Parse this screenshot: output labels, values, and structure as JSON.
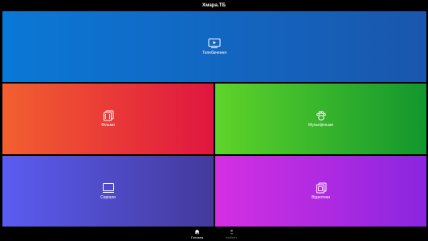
{
  "app": {
    "title": "Хмара.ТБ"
  },
  "tiles": [
    {
      "id": "tv",
      "label": "Телебачення",
      "icon": "tv-icon"
    },
    {
      "id": "films",
      "label": "Фільми",
      "icon": "film-stack-icon"
    },
    {
      "id": "cartoons",
      "label": "Мультфільми",
      "icon": "paw-icon"
    },
    {
      "id": "series",
      "label": "Серіали",
      "icon": "monitor-icon"
    },
    {
      "id": "vod",
      "label": "Відеотеки",
      "icon": "library-icon"
    }
  ],
  "bottom_nav": {
    "items": [
      {
        "label": "Головна",
        "icon": "home-icon",
        "active": true
      },
      {
        "label": "Кабінет",
        "icon": "user-icon",
        "active": false
      }
    ]
  },
  "colors": {
    "tv": [
      "#0a78d6",
      "#1a56ad"
    ],
    "films": [
      "#f2602f",
      "#e0163f"
    ],
    "cartoons": [
      "#5fd42a",
      "#12962d"
    ],
    "series": [
      "#5b5cf2",
      "#433a9a"
    ],
    "vod": [
      "#d52fe2",
      "#8a26e0"
    ],
    "background": "#000000"
  }
}
